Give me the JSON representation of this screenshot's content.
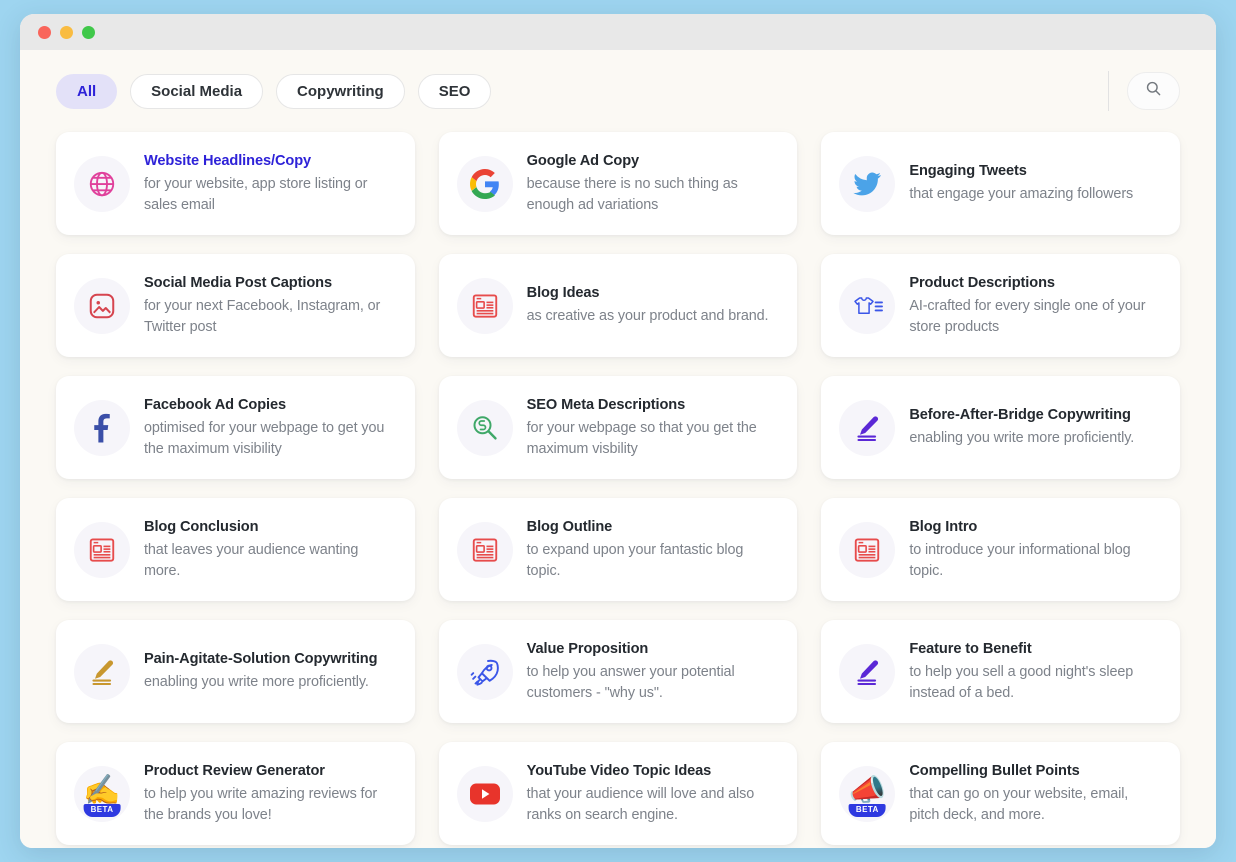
{
  "window": {
    "traffic_lights": [
      "close",
      "minimize",
      "maximize"
    ]
  },
  "toolbar": {
    "filters": [
      {
        "label": "All",
        "active": true
      },
      {
        "label": "Social Media",
        "active": false
      },
      {
        "label": "Copywriting",
        "active": false
      },
      {
        "label": "SEO",
        "active": false
      }
    ],
    "search_icon": "search-icon"
  },
  "colors": {
    "page_background": "#9ED5F0",
    "window_background": "#FBF9F4",
    "titlebar": "#E8E8E8",
    "card_background": "#FFFFFF",
    "accent": "#2E22D8",
    "pill_active_background": "#E3E1F8",
    "title_text": "#24292F",
    "description_text": "#7D828A",
    "beta_badge": "#2E39E0"
  },
  "cards": [
    {
      "title": "Website Headlines/Copy",
      "description": "for your website, app store listing or sales email",
      "icon": "globe-icon",
      "icon_color": "#E0409B",
      "highlighted": true,
      "beta": false
    },
    {
      "title": "Google Ad Copy",
      "description": "because there is no such thing as enough ad variations",
      "icon": "google-logo-icon",
      "icon_color": "#4285F4",
      "highlighted": false,
      "beta": false
    },
    {
      "title": "Engaging Tweets",
      "description": "that engage your amazing followers",
      "icon": "twitter-bird-icon",
      "icon_color": "#4BA3E8",
      "highlighted": false,
      "beta": false
    },
    {
      "title": "Social Media Post Captions",
      "description": "for your next Facebook, Instagram, or Twitter post",
      "icon": "image-frame-icon",
      "icon_color": "#D6454F",
      "highlighted": false,
      "beta": false
    },
    {
      "title": "Blog Ideas",
      "description": "as creative as your product and brand.",
      "icon": "newspaper-icon",
      "icon_color": "#E74C4C",
      "highlighted": false,
      "beta": false
    },
    {
      "title": "Product Descriptions",
      "description": "AI-crafted for every single one of your store products",
      "icon": "tshirt-list-icon",
      "icon_color": "#3B56E8",
      "highlighted": false,
      "beta": false
    },
    {
      "title": "Facebook Ad Copies",
      "description": "optimised for your webpage to get you the maximum visibility",
      "icon": "facebook-logo-icon",
      "icon_color": "#3B4FA8",
      "highlighted": false,
      "beta": false
    },
    {
      "title": "SEO Meta Descriptions",
      "description": "for your webpage so that you get the maximum visbility",
      "icon": "seo-magnifier-icon",
      "icon_color": "#3FA868",
      "highlighted": false,
      "beta": false
    },
    {
      "title": "Before-After-Bridge Copywriting",
      "description": "enabling you write more proficiently.",
      "icon": "pen-edit-icon",
      "icon_color": "#5B28D6",
      "highlighted": false,
      "beta": false
    },
    {
      "title": "Blog Conclusion",
      "description": "that leaves your audience wanting more.",
      "icon": "newspaper-icon",
      "icon_color": "#E74C4C",
      "highlighted": false,
      "beta": false
    },
    {
      "title": "Blog Outline",
      "description": "to expand upon your fantastic blog topic.",
      "icon": "newspaper-icon",
      "icon_color": "#E74C4C",
      "highlighted": false,
      "beta": false
    },
    {
      "title": "Blog Intro",
      "description": "to introduce your informational blog topic.",
      "icon": "newspaper-icon",
      "icon_color": "#E74C4C",
      "highlighted": false,
      "beta": false
    },
    {
      "title": "Pain-Agitate-Solution Copywriting",
      "description": "enabling you write more proficiently.",
      "icon": "pen-edit-icon",
      "icon_color": "#C8972F",
      "highlighted": false,
      "beta": false
    },
    {
      "title": "Value Proposition",
      "description": "to help you answer your potential customers - \"why us\".",
      "icon": "rocket-icon",
      "icon_color": "#3B56E8",
      "highlighted": false,
      "beta": false
    },
    {
      "title": "Feature to Benefit",
      "description": "to help you sell a good night's sleep instead of a bed.",
      "icon": "pen-edit-icon",
      "icon_color": "#5B28D6",
      "highlighted": false,
      "beta": false
    },
    {
      "title": "Product Review Generator",
      "description": "to help you write amazing reviews for the brands you love!",
      "icon": "writing-hand-icon",
      "icon_glyph": "✍️",
      "highlighted": false,
      "beta": true,
      "beta_label": "BETA"
    },
    {
      "title": "YouTube Video Topic Ideas",
      "description": "that your audience will love and also ranks on search engine.",
      "icon": "youtube-logo-icon",
      "icon_color": "#E8342B",
      "highlighted": false,
      "beta": false
    },
    {
      "title": "Compelling Bullet Points",
      "description": "that can go on your website, email, pitch deck, and more.",
      "icon": "megaphone-icon",
      "icon_glyph": "📣",
      "highlighted": false,
      "beta": true,
      "beta_label": "BETA"
    }
  ]
}
